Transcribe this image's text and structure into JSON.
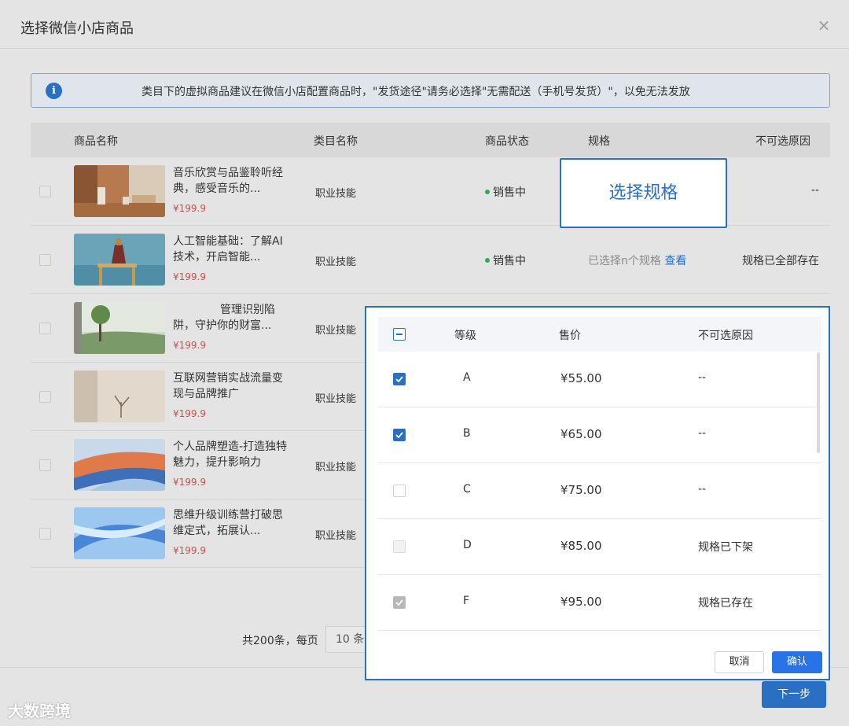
{
  "dialog": {
    "title": "选择微信小店商品",
    "close_icon": "×"
  },
  "notice": {
    "icon": "i",
    "text": "类目下的虚拟商品建议在微信小店配置商品时，\"发货途径\"请务必选择\"无需配送（手机号发货）\"，以免无法发放"
  },
  "table": {
    "headers": [
      "商品名称",
      "类目名称",
      "商品状态",
      "规格",
      "不可选原因"
    ],
    "rows": [
      {
        "name": "音乐欣赏与品鉴聆听经典，感受音乐的...",
        "price": "¥199.9",
        "category": "职业技能",
        "status": "销售中",
        "spec": "选择规格",
        "reason": "--"
      },
      {
        "name": "人工智能基础：了解AI 技术，开启智能...",
        "price": "¥199.9",
        "category": "职业技能",
        "status": "销售中",
        "spec_prefix": "已选择n个规格",
        "spec_link": "查看",
        "reason": "规格已全部存在"
      },
      {
        "name": "管理识别陷阱，守护你的财富...",
        "price": "¥199.9",
        "category": "职业技能"
      },
      {
        "name": "互联网营销实战流量变现与品牌推广",
        "price": "¥199.9",
        "category": "职业技能"
      },
      {
        "name": "个人品牌塑造-打造独特魅力，提升影响力",
        "price": "¥199.9",
        "category": "职业技能"
      },
      {
        "name": "思维升级训练营打破思维定式，拓展认...",
        "price": "¥199.9",
        "category": "职业技能"
      }
    ]
  },
  "pager": {
    "total_text": "共200条，每页",
    "page_size": "10 条"
  },
  "footer": {
    "next_label": "下一步"
  },
  "watermark": "大数跨境",
  "spec_popup": {
    "headers": [
      "等级",
      "售价",
      "不可选原因"
    ],
    "rows": [
      {
        "grade": "A",
        "price": "¥55.00",
        "reason": "--",
        "state": "checked"
      },
      {
        "grade": "B",
        "price": "¥65.00",
        "reason": "--",
        "state": "checked"
      },
      {
        "grade": "C",
        "price": "¥75.00",
        "reason": "--",
        "state": "unchecked"
      },
      {
        "grade": "D",
        "price": "¥85.00",
        "reason": "规格已下架",
        "state": "disabled"
      },
      {
        "grade": "F",
        "price": "¥95.00",
        "reason": "规格已存在",
        "state": "disabled-checked"
      }
    ],
    "cancel_label": "取消",
    "ok_label": "确认"
  },
  "colors": {
    "accent": "#2a6fc2",
    "price": "#c25252",
    "status_dot": "#2eaa55"
  }
}
